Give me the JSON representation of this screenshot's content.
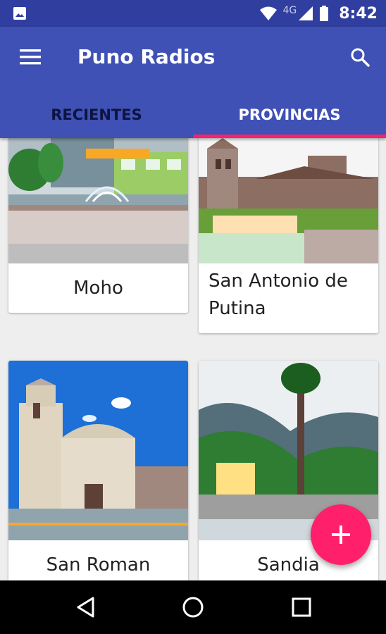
{
  "status_bar": {
    "network_label": "4G",
    "time": "8:42",
    "icons": [
      "image-icon",
      "wifi-icon",
      "signal-icon",
      "battery-icon"
    ]
  },
  "app_bar": {
    "title": "Puno Radios",
    "menu_icon": "menu-icon",
    "search_icon": "search-icon",
    "color": "#3f51b5",
    "status_color": "#303f9f"
  },
  "tabs": [
    {
      "label": "RECIENTES",
      "active": false
    },
    {
      "label": "PROVINCIAS",
      "active": true
    }
  ],
  "accent_color": "#ff1f6b",
  "cards": [
    {
      "name": "Moho"
    },
    {
      "name": "San Antonio de Putina"
    },
    {
      "name": "San Roman"
    },
    {
      "name": "Sandia"
    }
  ],
  "fab": {
    "icon": "plus-icon"
  },
  "nav_bar": {
    "icons": [
      "back-icon",
      "home-icon",
      "recents-icon"
    ]
  }
}
